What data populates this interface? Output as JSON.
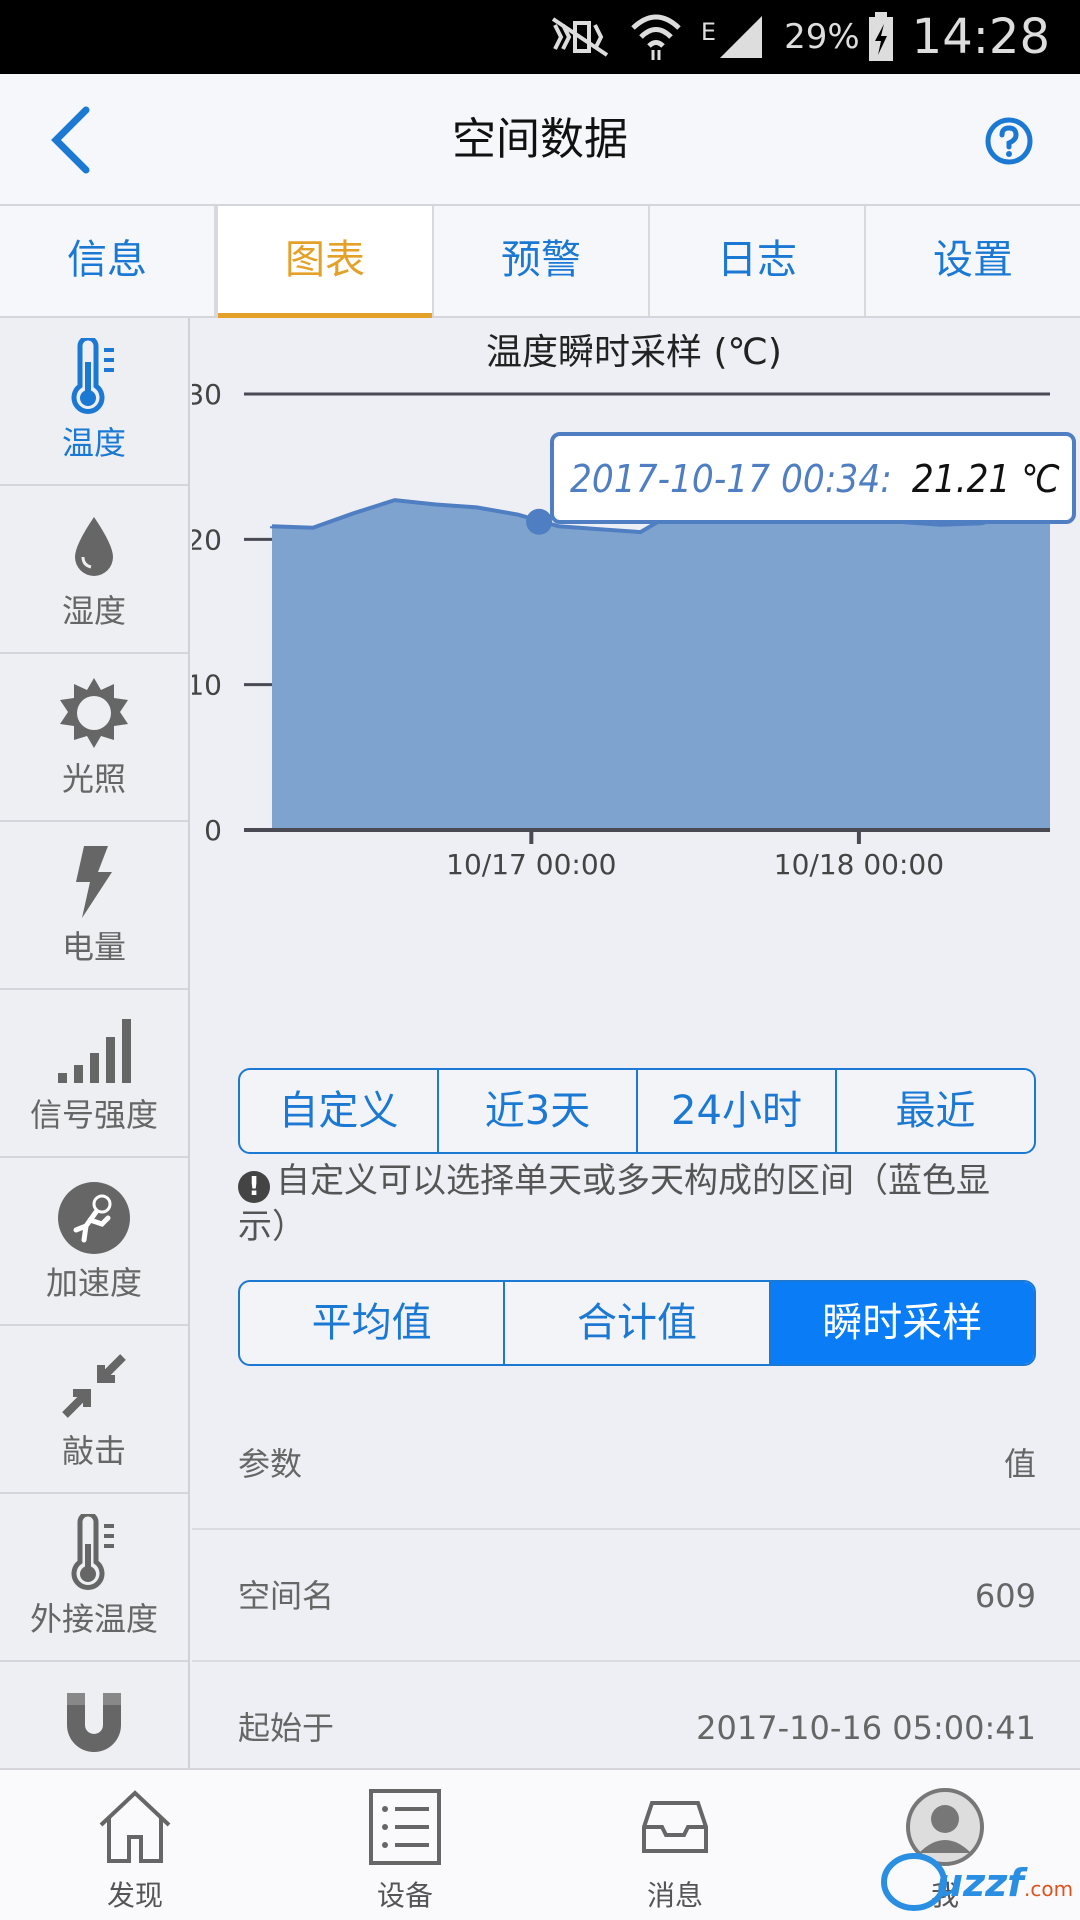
{
  "status_bar": {
    "battery": "29%",
    "time": "14:28",
    "network": "E"
  },
  "header": {
    "title": "空间数据"
  },
  "tabs": [
    {
      "label": "信息"
    },
    {
      "label": "图表",
      "active": true
    },
    {
      "label": "预警"
    },
    {
      "label": "日志"
    },
    {
      "label": "设置"
    }
  ],
  "sidebar": {
    "items": [
      {
        "label": "温度",
        "icon": "thermometer-icon",
        "active": true
      },
      {
        "label": "湿度",
        "icon": "drop-icon"
      },
      {
        "label": "光照",
        "icon": "sun-icon"
      },
      {
        "label": "电量",
        "icon": "lightning-icon"
      },
      {
        "label": "信号强度",
        "icon": "signal-bars-icon"
      },
      {
        "label": "加速度",
        "icon": "astronaut-icon"
      },
      {
        "label": "敲击",
        "icon": "collapse-arrows-icon"
      },
      {
        "label": "外接温度",
        "icon": "thermometer-outline-icon"
      },
      {
        "label": "",
        "icon": "magnet-icon"
      }
    ]
  },
  "chart_data": {
    "type": "area",
    "title": "温度瞬时采样 (℃)",
    "ylim": [
      0,
      30
    ],
    "yticks": [
      "0",
      "10",
      "20",
      "30"
    ],
    "xticks": [
      "10/17  00:00",
      "10/18  00:00"
    ],
    "x_range": [
      "2016-10-16 05:00",
      "2016-10-18 14:00"
    ],
    "grid": true,
    "fill_color": "#7fa3cf",
    "line_color": "#4f7fc2",
    "x": [
      "10/16 05:00",
      "10/16 08:00",
      "10/16 11:00",
      "10/16 14:00",
      "10/16 17:00",
      "10/16 20:00",
      "10/16 23:00",
      "10/17 02:00",
      "10/17 05:00",
      "10/17 08:00",
      "10/17 10:00",
      "10/17 12:00",
      "10/17 15:00",
      "10/17 18:00",
      "10/17 21:00",
      "10/18 00:00",
      "10/18 03:00",
      "10/18 06:00",
      "10/18 09:00",
      "10/18 12:00",
      "10/18 14:00"
    ],
    "values": [
      20.9,
      20.8,
      21.8,
      22.7,
      22.4,
      22.2,
      21.7,
      20.9,
      20.7,
      20.5,
      21.6,
      22.9,
      22.7,
      22.2,
      21.9,
      21.5,
      21.2,
      21.0,
      21.1,
      21.9,
      22.6
    ],
    "tooltip": {
      "label": "2017-10-17 00:34:",
      "value": "21.21 ℃",
      "x": "10/17 00:34",
      "y": 21.21
    }
  },
  "range_buttons": [
    {
      "label": "自定义"
    },
    {
      "label": "近3天"
    },
    {
      "label": "24小时"
    },
    {
      "label": "最近"
    }
  ],
  "hint": "自定义可以选择单天或多天构成的区间（蓝色显示）",
  "mode_buttons": [
    {
      "label": "平均值"
    },
    {
      "label": "合计值"
    },
    {
      "label": "瞬时采样",
      "active": true
    }
  ],
  "params": {
    "header": {
      "key": "参数",
      "value": "值"
    },
    "rows": [
      {
        "key": "空间名",
        "value": "609"
      },
      {
        "key": "起始于",
        "value": "2017-10-16 05:00:41"
      }
    ]
  },
  "bottom_nav": [
    {
      "label": "发现",
      "icon": "home-icon"
    },
    {
      "label": "设备",
      "icon": "list-icon"
    },
    {
      "label": "消息",
      "icon": "inbox-icon"
    },
    {
      "label": "我",
      "icon": "avatar-icon"
    }
  ],
  "colors": {
    "accent": "#1b78d3",
    "active_tab": "#e4a12a",
    "active_button": "#0a7cf5"
  }
}
